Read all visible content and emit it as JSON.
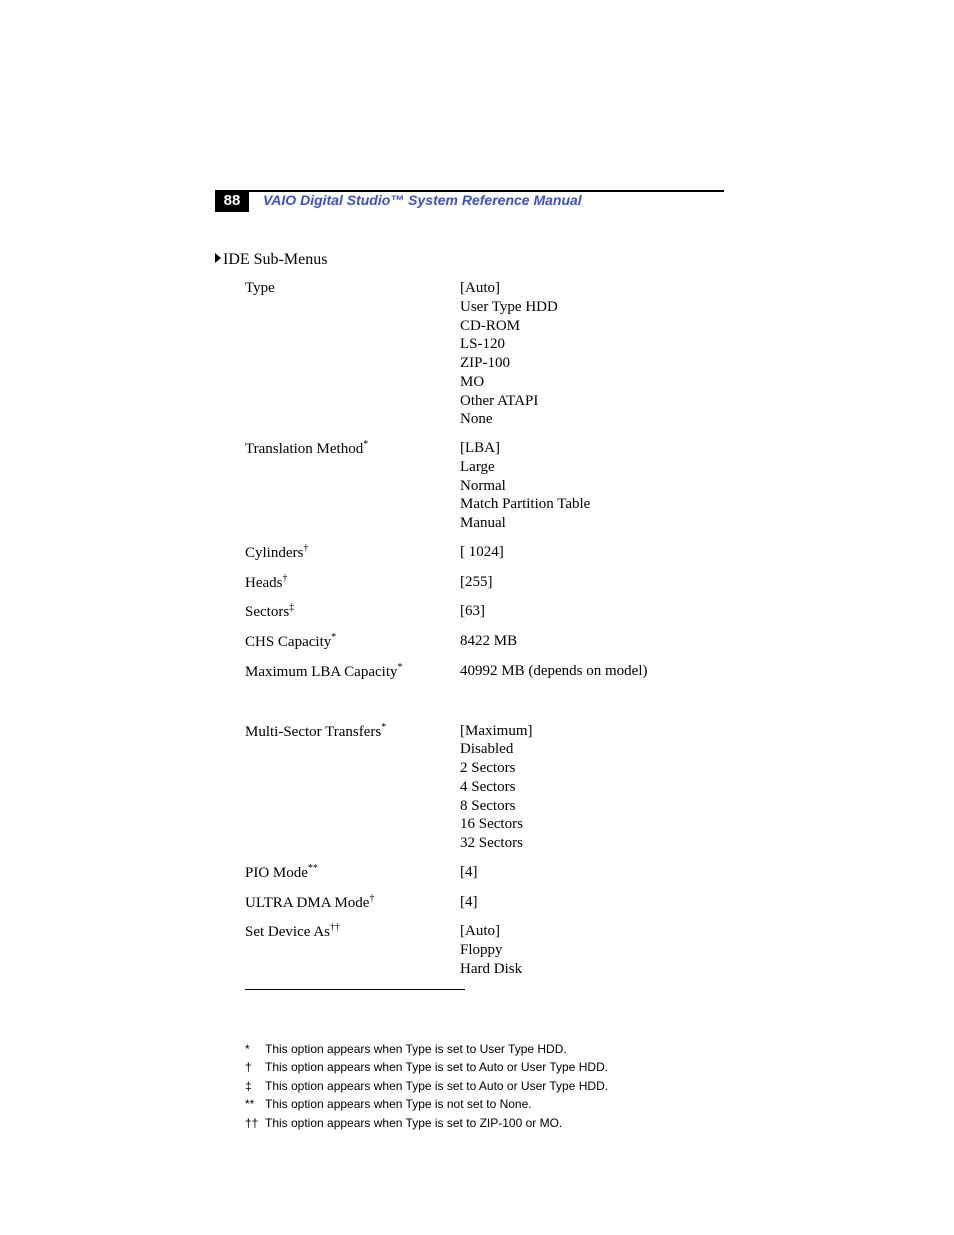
{
  "page_number": "88",
  "header_title": "VAIO Digital Studio™ System Reference Manual",
  "section_title": "IDE Sub-Menus",
  "rows": [
    {
      "label": "Type",
      "sup": "",
      "values": [
        "[Auto]",
        "User Type HDD",
        "CD-ROM",
        "LS-120",
        "ZIP-100",
        "MO",
        "Other ATAPI",
        "None"
      ]
    },
    {
      "label": "Translation Method",
      "sup": "*",
      "values": [
        "[LBA]",
        "Large",
        "Normal",
        "Match Partition Table",
        "Manual"
      ]
    },
    {
      "label": "Cylinders",
      "sup": "†",
      "values": [
        "[ 1024]"
      ]
    },
    {
      "label": "Heads",
      "sup": "†",
      "values": [
        "[255]"
      ]
    },
    {
      "label": "Sectors",
      "sup": "‡",
      "values": [
        "[63]"
      ]
    },
    {
      "label": "CHS Capacity",
      "sup": "*",
      "values": [
        "8422 MB"
      ]
    },
    {
      "label": "Maximum LBA Capacity",
      "sup": "*",
      "values": [
        "40992 MB (depends on model)"
      ]
    },
    {
      "gap": true
    },
    {
      "label": "Multi-Sector Transfers",
      "sup": "*",
      "values": [
        "[Maximum]",
        "Disabled",
        "2 Sectors",
        "4 Sectors",
        "8 Sectors",
        "16 Sectors",
        "32 Sectors"
      ]
    },
    {
      "label": "PIO Mode",
      "sup": "**",
      "values": [
        "[4]"
      ]
    },
    {
      "label": "ULTRA DMA Mode",
      "sup": "†",
      "values": [
        "[4]"
      ]
    },
    {
      "label": "Set Device As",
      "sup": "††",
      "values": [
        "[Auto]",
        "Floppy",
        "Hard Disk"
      ]
    }
  ],
  "footnotes": [
    {
      "sym": "*",
      "text": "This option appears when Type is set to User Type HDD."
    },
    {
      "sym": "†",
      "text": "This option appears when Type is set to Auto or User Type HDD."
    },
    {
      "sym": "‡",
      "text": "This option appears when Type is set to Auto or User Type HDD."
    },
    {
      "sym": "**",
      "text": "This option appears when Type is not set to None."
    },
    {
      "sym": "††",
      "text": "This option appears when Type is set to ZIP-100 or MO."
    }
  ]
}
